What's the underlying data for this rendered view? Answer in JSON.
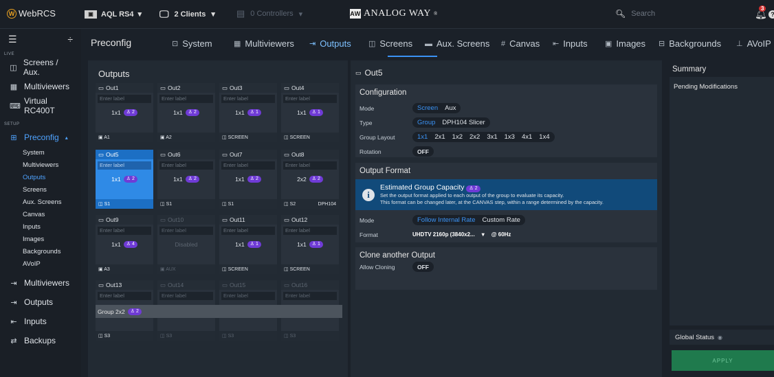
{
  "app": {
    "logo": "WebRCS",
    "logo_letter": "W"
  },
  "topbar": {
    "device": "AQL RS4",
    "clients": "2 Clients",
    "controllers": "0 Controllers",
    "brand": "ANALOG WAY",
    "brand_mark": "®",
    "search_placeholder": "Search",
    "notif_count": "3",
    "help": "?"
  },
  "sidebar": {
    "live_label": "LIVE",
    "live_items": [
      {
        "label": "Screens / Aux.",
        "icon": "screens-icon"
      },
      {
        "label": "Multiviewers",
        "icon": "multiviewer-icon"
      },
      {
        "label": "Virtual RC400T",
        "icon": "keyboard-icon"
      }
    ],
    "setup_label": "SETUP",
    "preconfig": "Preconfig",
    "sub_items": [
      "System",
      "Multiviewers",
      "Outputs",
      "Screens",
      "Aux. Screens",
      "Canvas",
      "Inputs",
      "Images",
      "Backgrounds",
      "AVoIP"
    ],
    "bottom_items": [
      {
        "label": "Multiviewers"
      },
      {
        "label": "Outputs"
      },
      {
        "label": "Inputs"
      },
      {
        "label": "Backups"
      }
    ]
  },
  "header": {
    "title": "Preconfig",
    "tabs": [
      {
        "label": "System"
      },
      {
        "label": "Multiviewers"
      },
      {
        "label": "Outputs"
      },
      {
        "label": "Screens"
      },
      {
        "label": "Aux. Screens"
      },
      {
        "label": "Canvas"
      },
      {
        "label": "Inputs"
      },
      {
        "label": "Images"
      },
      {
        "label": "Backgrounds"
      },
      {
        "label": "AVoIP"
      }
    ]
  },
  "outputs": {
    "title": "Outputs",
    "label_placeholder": "Enter label",
    "group_label": "Group 2x2",
    "group_badge": "2",
    "items": [
      {
        "name": "Out1",
        "layout": "1x1",
        "badge": "2",
        "footer": "A1",
        "footer_right": ""
      },
      {
        "name": "Out2",
        "layout": "1x1",
        "badge": "2",
        "footer": "A2",
        "footer_right": ""
      },
      {
        "name": "Out3",
        "layout": "1x1",
        "badge": "1",
        "footer": "SCREEN",
        "footer_right": ""
      },
      {
        "name": "Out4",
        "layout": "1x1",
        "badge": "1",
        "footer": "SCREEN",
        "footer_right": ""
      },
      {
        "name": "Out5",
        "layout": "1x1",
        "badge": "2",
        "footer": "S1",
        "footer_right": ""
      },
      {
        "name": "Out6",
        "layout": "1x1",
        "badge": "2",
        "footer": "S1",
        "footer_right": ""
      },
      {
        "name": "Out7",
        "layout": "1x1",
        "badge": "2",
        "footer": "S1",
        "footer_right": ""
      },
      {
        "name": "Out8",
        "layout": "2x2",
        "badge": "2",
        "footer": "S2",
        "footer_right": "DPH104"
      },
      {
        "name": "Out9",
        "layout": "1x1",
        "badge": "4",
        "footer": "A3",
        "footer_right": ""
      },
      {
        "name": "Out10",
        "layout": "Disabled",
        "badge": "",
        "footer": "AUX",
        "footer_right": ""
      },
      {
        "name": "Out11",
        "layout": "1x1",
        "badge": "1",
        "footer": "SCREEN",
        "footer_right": ""
      },
      {
        "name": "Out12",
        "layout": "1x1",
        "badge": "1",
        "footer": "SCREEN",
        "footer_right": ""
      },
      {
        "name": "Out13",
        "layout": "",
        "badge": "",
        "footer": "S3",
        "footer_right": ""
      },
      {
        "name": "Out14",
        "layout": "",
        "badge": "",
        "footer": "S3",
        "footer_right": ""
      },
      {
        "name": "Out15",
        "layout": "",
        "badge": "",
        "footer": "S3",
        "footer_right": ""
      },
      {
        "name": "Out16",
        "layout": "",
        "badge": "",
        "footer": "S3",
        "footer_right": ""
      }
    ]
  },
  "detail": {
    "title": "Out5",
    "config": {
      "title": "Configuration",
      "mode_label": "Mode",
      "mode_options": [
        "Screen",
        "Aux"
      ],
      "type_label": "Type",
      "type_options": [
        "Group",
        "DPH104 Slicer"
      ],
      "layout_label": "Group Layout",
      "layout_options": [
        "1x1",
        "2x1",
        "1x2",
        "2x2",
        "3x1",
        "1x3",
        "4x1",
        "1x4"
      ],
      "rotation_label": "Rotation",
      "rotation_value": "OFF"
    },
    "format": {
      "title": "Output Format",
      "info_title": "Estimated Group Capacity",
      "info_badge": "2",
      "info_line1": "Set the output format applied to each output of the group to evaluate its capacity.",
      "info_line2": "This format can be changed later, at the CANVAS step, within a range determined by the capacity.",
      "mode_label": "Mode",
      "mode_options": [
        "Follow Internal Rate",
        "Custom Rate"
      ],
      "format_label": "Format",
      "format_value": "UHDTV 2160p (3840x2...",
      "rate": "@ 60Hz"
    },
    "clone": {
      "title": "Clone another Output",
      "label": "Allow Cloning",
      "value": "OFF"
    }
  },
  "summary": {
    "title": "Summary",
    "pending": "Pending Modifications",
    "global_status": "Global Status",
    "apply": "APPLY"
  },
  "colors": {
    "accent": "#3b93f5",
    "badge": "#6f3bd6",
    "apply": "#1f7a4d"
  }
}
